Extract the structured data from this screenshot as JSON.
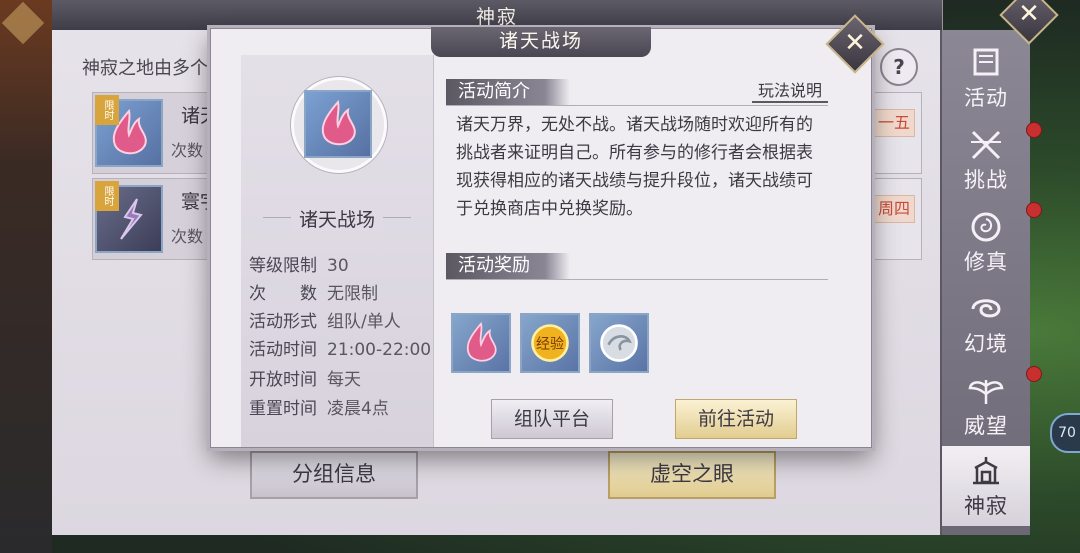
{
  "window": {
    "title": "神寂",
    "intro": "神寂之地由多个"
  },
  "activities": [
    {
      "tag": "限时",
      "name": "诸天",
      "count_label": "次数",
      "day": "一五"
    },
    {
      "tag": "限时",
      "name": "寰宇",
      "count_label": "次数",
      "day": "周四"
    }
  ],
  "bottom_buttons": {
    "group_info": "分组信息",
    "void_eye": "虚空之眼"
  },
  "tabs": [
    {
      "label": "活动",
      "icon": "flag-icon",
      "badge": true
    },
    {
      "label": "挑战",
      "icon": "crossed-swords-icon",
      "badge": true
    },
    {
      "label": "修真",
      "icon": "swirl-icon",
      "badge": false
    },
    {
      "label": "幻境",
      "icon": "vortex-icon",
      "badge": true
    },
    {
      "label": "威望",
      "icon": "wings-icon",
      "badge": false
    },
    {
      "label": "神寂",
      "icon": "temple-icon",
      "badge": false,
      "active": true
    }
  ],
  "modal": {
    "title": "诸天战场",
    "name": "诸天战场",
    "info": [
      {
        "key": "等级限制",
        "value": "30"
      },
      {
        "key": "次　　数",
        "value": "无限制"
      },
      {
        "key": "活动形式",
        "value": "组队/单人"
      },
      {
        "key": "活动时间",
        "value": "21:00-22:00"
      },
      {
        "key": "开放时间",
        "value": "每天"
      },
      {
        "key": "重置时间",
        "value": "凌晨4点"
      }
    ],
    "intro_heading": "活动简介",
    "rules_link": "玩法说明",
    "description": "诸天万界，无处不战。诸天战场随时欢迎所有的挑战者来证明自己。所有参与的修行者会根据表现获得相应的诸天战绩与提升段位，诸天战绩可于兑换商店中兑换奖励。",
    "reward_heading": "活动奖励",
    "rewards": [
      {
        "icon": "flame-gem-icon"
      },
      {
        "icon": "exp-coin-icon",
        "text": "经验"
      },
      {
        "icon": "silver-coin-icon"
      }
    ],
    "team_button": "组队平台",
    "go_button": "前往活动"
  },
  "fps": "70"
}
